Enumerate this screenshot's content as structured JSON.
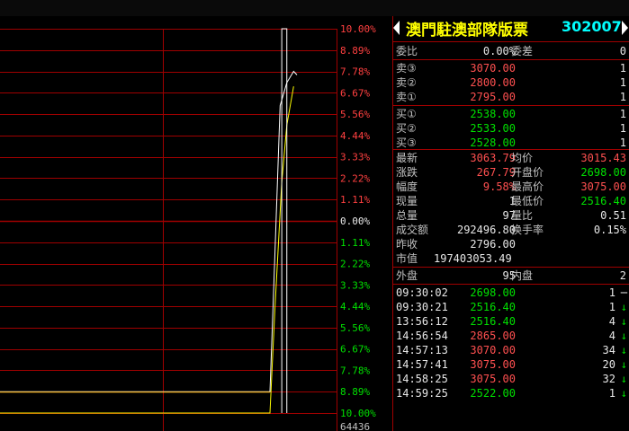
{
  "stock": {
    "name": "澳門駐澳部隊版票",
    "code": "302007"
  },
  "chart_data": {
    "type": "line",
    "title": "",
    "y_labels_upper": [
      "10.00%",
      "8.89%",
      "7.78%",
      "6.67%",
      "5.56%",
      "4.44%",
      "3.33%",
      "2.22%",
      "1.11%"
    ],
    "y_label_mid": "0.00%",
    "y_labels_lower": [
      "1.11%",
      "2.22%",
      "3.33%",
      "4.44%",
      "5.56%",
      "6.67%",
      "7.78%",
      "8.89%",
      "10.00%"
    ],
    "volume_label": "64436",
    "prev_close": 2796.0,
    "yrange_pct": [
      -10,
      10
    ],
    "price_series": [
      {
        "t": 0.0,
        "pct": -8.89
      },
      {
        "t": 0.8,
        "pct": -8.89
      },
      {
        "t": 0.81,
        "pct": -4.0
      },
      {
        "t": 0.83,
        "pct": 6.0
      },
      {
        "t": 0.85,
        "pct": 7.2
      },
      {
        "t": 0.87,
        "pct": 7.78
      },
      {
        "t": 0.88,
        "pct": 7.6
      }
    ],
    "avg_series": [
      {
        "t": 0.0,
        "pct": -10.0
      },
      {
        "t": 0.8,
        "pct": -10.0
      },
      {
        "t": 0.815,
        "pct": -4.5
      },
      {
        "t": 0.835,
        "pct": 2.0
      },
      {
        "t": 0.85,
        "pct": 5.0
      },
      {
        "t": 0.87,
        "pct": 7.0
      }
    ],
    "spike": {
      "t_start": 0.835,
      "t_end": 0.85,
      "top_pct": 10.0
    }
  },
  "commission": {
    "ratio_label": "委比",
    "ratio": "0.00%",
    "diff_label": "委差",
    "diff": "0"
  },
  "sell": [
    {
      "label": "卖③",
      "price": "3070.00",
      "vol": "1"
    },
    {
      "label": "卖②",
      "price": "2800.00",
      "vol": "1"
    },
    {
      "label": "卖①",
      "price": "2795.00",
      "vol": "1"
    }
  ],
  "buy": [
    {
      "label": "买①",
      "price": "2538.00",
      "vol": "1"
    },
    {
      "label": "买②",
      "price": "2533.00",
      "vol": "1"
    },
    {
      "label": "买③",
      "price": "2528.00",
      "vol": "1"
    }
  ],
  "quote": {
    "latest_label": "最新",
    "latest": "3063.79",
    "avg_label": "均价",
    "avg": "3015.43",
    "change_label": "涨跌",
    "change": "267.79",
    "open_label": "开盘价",
    "open": "2698.00",
    "range_label": "幅度",
    "range": "9.58%",
    "high_label": "最高价",
    "high": "3075.00",
    "cur_vol_label": "现量",
    "cur_vol": "1",
    "low_label": "最低价",
    "low": "2516.40",
    "total_vol_label": "总量",
    "total_vol": "97",
    "vol_ratio_label": "量比",
    "vol_ratio": "0.51",
    "amount_label": "成交额",
    "amount": "292496.80",
    "turnover_label": "换手率",
    "turnover": "0.15%",
    "prev_label": "昨收",
    "prev": "2796.00",
    "mcap_label": "市值",
    "mcap": "197403053.49"
  },
  "flow": {
    "outer_label": "外盘",
    "outer": "95",
    "inner_label": "内盘",
    "inner": "2"
  },
  "ticks": [
    {
      "time": "09:30:02",
      "price": "2698.00",
      "pc": "green",
      "vol": "1",
      "dir": "─",
      "dc": "white"
    },
    {
      "time": "09:30:21",
      "price": "2516.40",
      "pc": "green",
      "vol": "1",
      "dir": "↓",
      "dc": "green"
    },
    {
      "time": "13:56:12",
      "price": "2516.40",
      "pc": "green",
      "vol": "4",
      "dir": "↓",
      "dc": "green"
    },
    {
      "time": "14:56:54",
      "price": "2865.00",
      "pc": "red",
      "vol": "4",
      "dir": "↓",
      "dc": "green"
    },
    {
      "time": "14:57:13",
      "price": "3070.00",
      "pc": "red",
      "vol": "34",
      "dir": "↓",
      "dc": "green"
    },
    {
      "time": "14:57:41",
      "price": "3075.00",
      "pc": "red",
      "vol": "20",
      "dir": "↓",
      "dc": "green"
    },
    {
      "time": "14:58:25",
      "price": "3075.00",
      "pc": "red",
      "vol": "32",
      "dir": "↓",
      "dc": "green"
    },
    {
      "time": "14:59:25",
      "price": "2522.00",
      "pc": "green",
      "vol": "1",
      "dir": "↓",
      "dc": "green"
    }
  ]
}
